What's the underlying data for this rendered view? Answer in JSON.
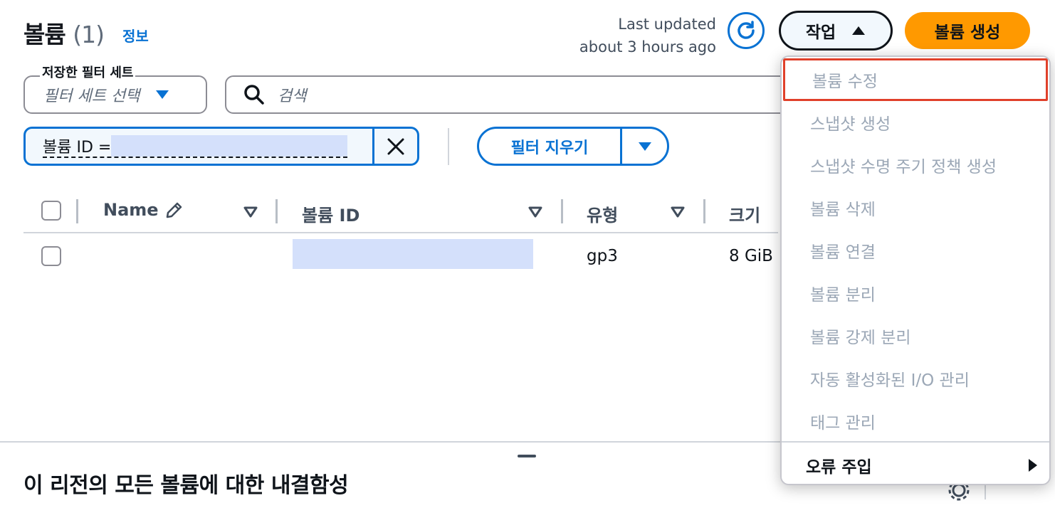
{
  "header": {
    "title": "볼륨",
    "count": "(1)",
    "info_link": "정보",
    "last_updated_line1": "Last updated",
    "last_updated_line2": "about 3 hours ago",
    "actions_label": "작업",
    "create_label": "볼륨 생성"
  },
  "filters": {
    "saved_filter_set_label": "저장한 필터 세트",
    "saved_filter_set_placeholder": "필터 세트 선택",
    "search_placeholder": "검색",
    "token_label": "볼륨 ID = ",
    "clear_filters_label": "필터 지우기"
  },
  "table": {
    "columns": [
      "Name",
      "볼륨 ID",
      "유형",
      "크기"
    ],
    "rows": [
      {
        "name": "",
        "volume_id": "",
        "type": "gp3",
        "size": "8 GiB"
      }
    ]
  },
  "actions_menu": {
    "items": [
      "볼륨 수정",
      "스냅샷 생성",
      "스냅샷 수명 주기 정책 생성",
      "볼륨 삭제",
      "볼륨 연결",
      "볼륨 분리",
      "볼륨 강제 분리",
      "자동 활성화된 I/O 관리",
      "태그 관리"
    ],
    "submenu_label": "오류 주입"
  },
  "bottom_section": {
    "title": "이 리전의 모든 볼륨에 대한 내결함성"
  },
  "colors": {
    "accent": "#0972d3",
    "primary_button": "#ff9900",
    "highlight_border": "#e0402a",
    "redacted": "#d4e0fb"
  }
}
